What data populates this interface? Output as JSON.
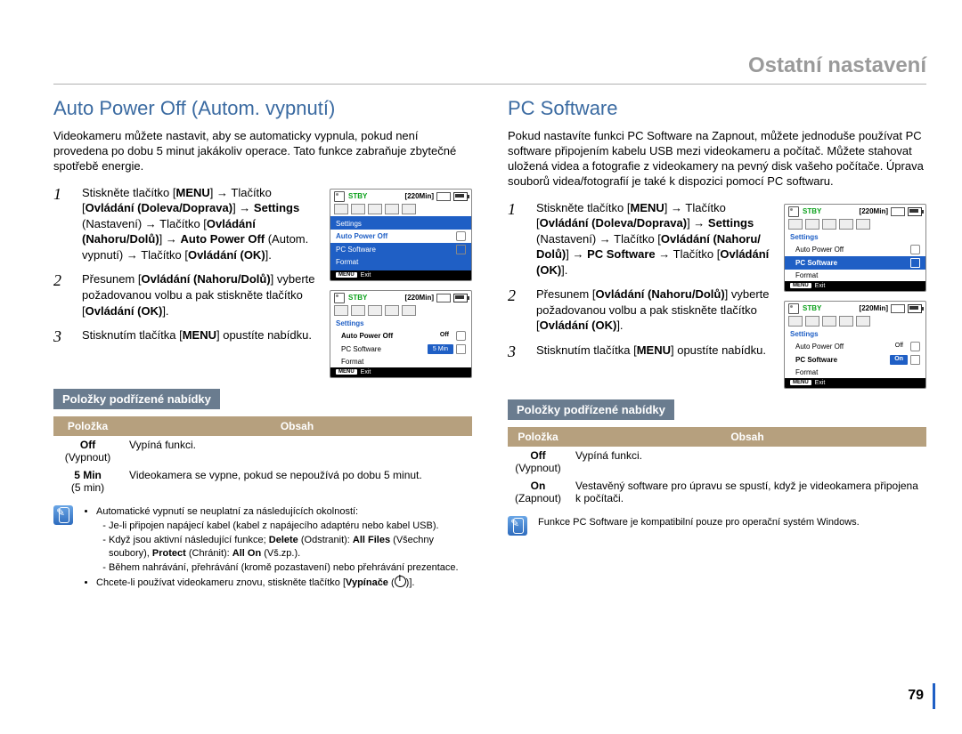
{
  "page": {
    "header": "Ostatní nastavení",
    "number": "79"
  },
  "left": {
    "heading": "Auto Power Off (Autom. vypnutí)",
    "intro": "Videokameru můžete nastavit, aby se automaticky vypnula, pokud není provedena po dobu 5 minut jakákoliv operace. Tato funkce zabraňuje zbytečné spotřebě energie.",
    "steps": {
      "s1_a": "Stiskněte tlačítko [",
      "s1_menu": "MENU",
      "s1_b": "] → Tlačítko [",
      "s1_ovl1": "Ovládání (Doleva/Doprava)",
      "s1_c": "] → ",
      "s1_set": "Settings",
      "s1_d": " (Nastavení) → Tlačítko [",
      "s1_ovl2": "Ovládání (Nahoru/Dolů)",
      "s1_e": "] → ",
      "s1_apo": "Auto Power Off",
      "s1_f": " (Autom. vypnutí) → Tlačítko [",
      "s1_ok": "Ovládání (OK)",
      "s1_g": "].",
      "s2_a": "Přesunem [",
      "s2_ovl": "Ovládání (Nahoru/Dolů)",
      "s2_b": "] vyberte požadovanou volbu a pak stiskněte tlačítko [",
      "s2_ok": "Ovládání (OK)",
      "s2_c": "].",
      "s3_a": "Stisknutím tlačítka [",
      "s3_menu": "MENU",
      "s3_b": "] opustíte nabídku."
    },
    "subhead": "Položky podřízené nabídky",
    "table": {
      "h1": "Položka",
      "h2": "Obsah",
      "r1c1a": "Off",
      "r1c1b": "(Vypnout)",
      "r1c2": "Vypíná funkci.",
      "r2c1a": "5 Min",
      "r2c1b": "(5 min)",
      "r2c2": "Videokamera se vypne, pokud se nepoužívá po dobu 5 minut."
    },
    "notes": {
      "n1": "Automatické vypnutí se neuplatní za následujících okolností:",
      "n1a": "Je-li připojen napájecí kabel (kabel z napájecího adaptéru nebo kabel USB).",
      "n1b_a": "Když jsou aktivní následující funkce; ",
      "n1b_del": "Delete",
      "n1b_b": " (Odstranit): ",
      "n1b_af": "All Files",
      "n1b_c": " (Všechny soubory), ",
      "n1b_pr": "Protect",
      "n1b_d": " (Chránit): ",
      "n1b_ao": "All On",
      "n1b_e": " (Vš.zp.).",
      "n1c": "Během nahrávání, přehrávání (kromě pozastavení) nebo přehrávání prezentace.",
      "n2_a": "Chcete-li používat videokameru znovu, stiskněte tlačítko [",
      "n2_vyp": "Vypínače",
      "n2_b": " (",
      "n2_c": ")]."
    },
    "lcd": {
      "stby": "STBY",
      "min": "[220Min]",
      "settings": "Settings",
      "apo": "Auto Power Off",
      "pcs": "PC Software",
      "format": "Format",
      "exit": "Exit",
      "m": "MENU",
      "off": "Off",
      "fivemin": "5 Min"
    }
  },
  "right": {
    "heading": "PC Software",
    "intro": "Pokud nastavíte funkci PC Software na Zapnout, můžete jednoduše používat PC software připojením kabelu USB mezi videokameru a počítač. Můžete stahovat uložená videa a fotografie z videokamery na pevný disk vašeho počítače. Úprava souborů videa/fotografií je také k dispozici pomocí PC softwaru.",
    "steps": {
      "s1_a": "Stiskněte tlačítko [",
      "s1_menu": "MENU",
      "s1_b": "] → Tlačítko [",
      "s1_ovl1": "Ovládání (Doleva/Doprava)",
      "s1_c": "] → ",
      "s1_set": "Settings",
      "s1_d": " (Nastavení) → Tlačítko [",
      "s1_ovl2": "Ovládání (Nahoru/ Dolů)",
      "s1_e": "] → ",
      "s1_pcs": "PC Software",
      "s1_f": " → Tlačítko [",
      "s1_ok": "Ovládání (OK)",
      "s1_g": "].",
      "s2_a": "Přesunem [",
      "s2_ovl": "Ovládání (Nahoru/Dolů)",
      "s2_b": "] vyberte požadovanou volbu a pak stiskněte tlačítko [",
      "s2_ok": "Ovládání (OK)",
      "s2_c": "].",
      "s3_a": "Stisknutím tlačítka [",
      "s3_menu": "MENU",
      "s3_b": "] opustíte nabídku."
    },
    "subhead": "Položky podřízené nabídky",
    "table": {
      "h1": "Položka",
      "h2": "Obsah",
      "r1c1a": "Off",
      "r1c1b": "(Vypnout)",
      "r1c2": "Vypíná funkci.",
      "r2c1a": "On",
      "r2c1b": "(Zapnout)",
      "r2c2": "Vestavěný software pro úpravu se spustí, když je videokamera připojena k počítači."
    },
    "note": "Funkce PC Software je kompatibilní pouze pro operační systém Windows.",
    "lcd": {
      "stby": "STBY",
      "min": "[220Min]",
      "settings": "Settings",
      "apo": "Auto Power Off",
      "pcs": "PC Software",
      "format": "Format",
      "exit": "Exit",
      "m": "MENU",
      "off": "Off",
      "on": "On"
    }
  }
}
